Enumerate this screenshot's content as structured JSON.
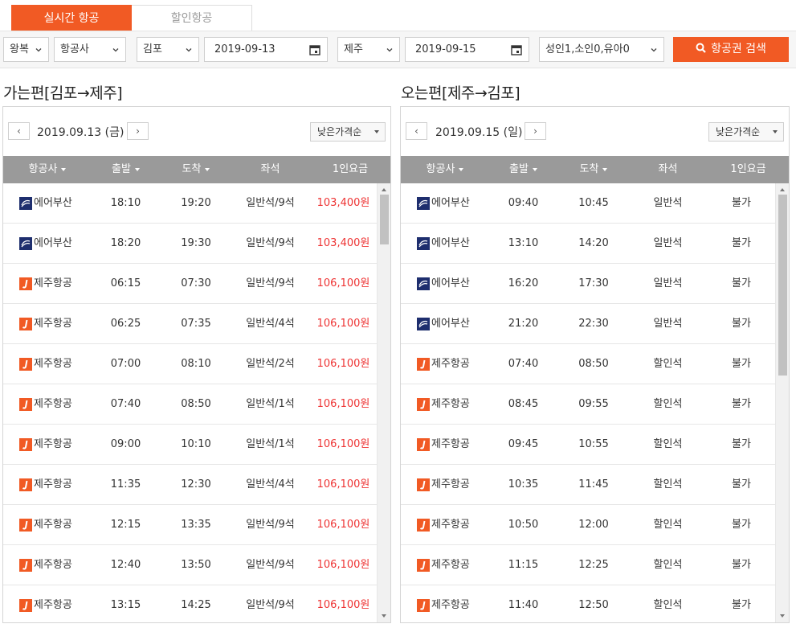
{
  "tabs": [
    {
      "label": "실시간 항공",
      "active": true
    },
    {
      "label": "할인항공",
      "active": false
    }
  ],
  "search": {
    "trip_type": "왕복",
    "airline": "항공사",
    "origin": "김포",
    "depart_date": "2019-09-13",
    "destination": "제주",
    "return_date": "2019-09-15",
    "passengers": "성인1,소인0,유아0",
    "search_label": "항공권 검색"
  },
  "accent_color": "#f15a24",
  "price_color": "#e33333",
  "outbound": {
    "title": "가는편[김포→제주]",
    "prev": "‹",
    "next": "›",
    "date": "2019.09.13 (금)",
    "sort": "낮은가격순",
    "headers": {
      "airline": "항공사",
      "dep": "출발",
      "arr": "도착",
      "seat": "좌석",
      "fare": "1인요금"
    },
    "rows": [
      {
        "airline": "에어부산",
        "logo": "airbusan-logo",
        "dep": "18:10",
        "arr": "19:20",
        "seat": "일반석/9석",
        "fare": "103,400원"
      },
      {
        "airline": "에어부산",
        "logo": "airbusan-logo",
        "dep": "18:20",
        "arr": "19:30",
        "seat": "일반석/9석",
        "fare": "103,400원"
      },
      {
        "airline": "제주항공",
        "logo": "jejuair-logo",
        "dep": "06:15",
        "arr": "07:30",
        "seat": "일반석/9석",
        "fare": "106,100원"
      },
      {
        "airline": "제주항공",
        "logo": "jejuair-logo",
        "dep": "06:25",
        "arr": "07:35",
        "seat": "일반석/4석",
        "fare": "106,100원"
      },
      {
        "airline": "제주항공",
        "logo": "jejuair-logo",
        "dep": "07:00",
        "arr": "08:10",
        "seat": "일반석/2석",
        "fare": "106,100원"
      },
      {
        "airline": "제주항공",
        "logo": "jejuair-logo",
        "dep": "07:40",
        "arr": "08:50",
        "seat": "일반석/1석",
        "fare": "106,100원"
      },
      {
        "airline": "제주항공",
        "logo": "jejuair-logo",
        "dep": "09:00",
        "arr": "10:10",
        "seat": "일반석/1석",
        "fare": "106,100원"
      },
      {
        "airline": "제주항공",
        "logo": "jejuair-logo",
        "dep": "11:35",
        "arr": "12:30",
        "seat": "일반석/4석",
        "fare": "106,100원"
      },
      {
        "airline": "제주항공",
        "logo": "jejuair-logo",
        "dep": "12:15",
        "arr": "13:35",
        "seat": "일반석/9석",
        "fare": "106,100원"
      },
      {
        "airline": "제주항공",
        "logo": "jejuair-logo",
        "dep": "12:40",
        "arr": "13:50",
        "seat": "일반석/9석",
        "fare": "106,100원"
      },
      {
        "airline": "제주항공",
        "logo": "jejuair-logo",
        "dep": "13:15",
        "arr": "14:25",
        "seat": "일반석/9석",
        "fare": "106,100원"
      }
    ]
  },
  "inbound": {
    "title": "오는편[제주→김포]",
    "prev": "‹",
    "next": "›",
    "date": "2019.09.15 (일)",
    "sort": "낮은가격순",
    "headers": {
      "airline": "항공사",
      "dep": "출발",
      "arr": "도착",
      "seat": "좌석",
      "fare": "1인요금"
    },
    "rows": [
      {
        "airline": "에어부산",
        "logo": "airbusan-logo",
        "dep": "09:40",
        "arr": "10:45",
        "seat": "일반석",
        "fare": "불가"
      },
      {
        "airline": "에어부산",
        "logo": "airbusan-logo",
        "dep": "13:10",
        "arr": "14:20",
        "seat": "일반석",
        "fare": "불가"
      },
      {
        "airline": "에어부산",
        "logo": "airbusan-logo",
        "dep": "16:20",
        "arr": "17:30",
        "seat": "일반석",
        "fare": "불가"
      },
      {
        "airline": "에어부산",
        "logo": "airbusan-logo",
        "dep": "21:20",
        "arr": "22:30",
        "seat": "일반석",
        "fare": "불가"
      },
      {
        "airline": "제주항공",
        "logo": "jejuair-logo",
        "dep": "07:40",
        "arr": "08:50",
        "seat": "할인석",
        "fare": "불가"
      },
      {
        "airline": "제주항공",
        "logo": "jejuair-logo",
        "dep": "08:45",
        "arr": "09:55",
        "seat": "할인석",
        "fare": "불가"
      },
      {
        "airline": "제주항공",
        "logo": "jejuair-logo",
        "dep": "09:45",
        "arr": "10:55",
        "seat": "할인석",
        "fare": "불가"
      },
      {
        "airline": "제주항공",
        "logo": "jejuair-logo",
        "dep": "10:35",
        "arr": "11:45",
        "seat": "할인석",
        "fare": "불가"
      },
      {
        "airline": "제주항공",
        "logo": "jejuair-logo",
        "dep": "10:50",
        "arr": "12:00",
        "seat": "할인석",
        "fare": "불가"
      },
      {
        "airline": "제주항공",
        "logo": "jejuair-logo",
        "dep": "11:15",
        "arr": "12:25",
        "seat": "할인석",
        "fare": "불가"
      },
      {
        "airline": "제주항공",
        "logo": "jejuair-logo",
        "dep": "11:40",
        "arr": "12:50",
        "seat": "할인석",
        "fare": "불가"
      }
    ]
  }
}
